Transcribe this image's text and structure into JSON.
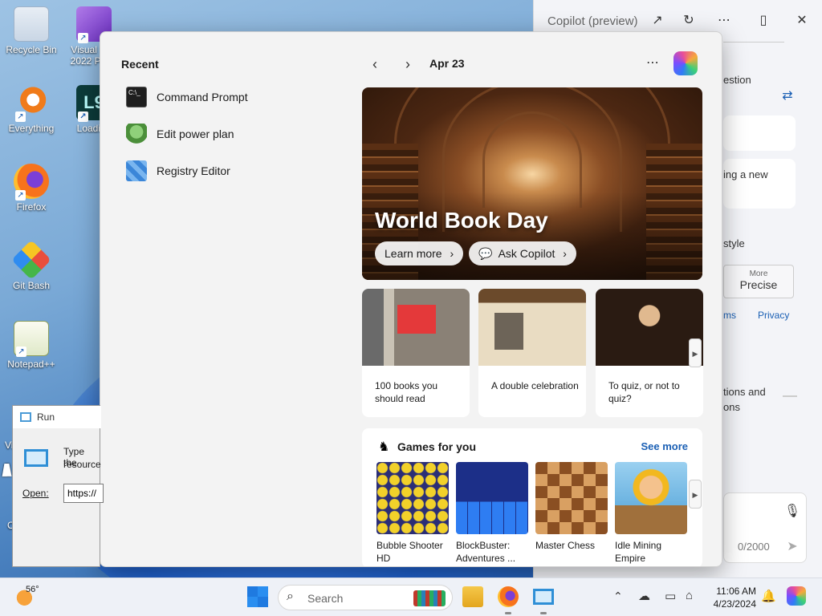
{
  "desktop": {
    "icons": [
      {
        "label": "Recycle Bin"
      },
      {
        "label": "Visual St... 2022 Pre..."
      },
      {
        "label": "Everything"
      },
      {
        "label": "Loading"
      },
      {
        "label": "Firefox"
      },
      {
        "label": "Git Bash"
      },
      {
        "label": "Notepad++"
      }
    ],
    "badge_pre": "PI",
    "partial_text_v": "Vi",
    "partial_text_c": "C"
  },
  "copilot": {
    "title": "Copilot (preview)",
    "icons": [
      "open-external-icon",
      "refresh-icon",
      "more-icon",
      "split-view-icon",
      "close-icon"
    ],
    "snippet_question": "estion",
    "snippet_new": "ing a new",
    "snippet_style": "style",
    "precise_small": "More",
    "precise_label": "Precise",
    "link_terms": "ms",
    "link_privacy": "Privacy",
    "snippet_options_1": "tions and",
    "snippet_options_2": "ons",
    "char_count": "0/2000"
  },
  "start_menu": {
    "recent_header": "Recent",
    "recent_items": [
      {
        "label": "Command Prompt"
      },
      {
        "label": "Edit power plan"
      },
      {
        "label": "Registry Editor"
      }
    ],
    "date": "Apr 23",
    "hero": {
      "title": "World Book Day",
      "learn_more": "Learn more",
      "ask_copilot": "Ask Copilot"
    },
    "cards": [
      {
        "caption": "100 books you should read"
      },
      {
        "caption": "A double celebration"
      },
      {
        "caption": "To quiz, or not to quiz?"
      }
    ],
    "games": {
      "header": "Games for you",
      "see_more": "See more",
      "items": [
        {
          "name": "Bubble Shooter HD"
        },
        {
          "name": "BlockBuster: Adventures ..."
        },
        {
          "name": "Master Chess"
        },
        {
          "name": "Idle Mining Empire"
        }
      ]
    }
  },
  "run_dialog": {
    "title": "Run",
    "prompt_line1": "Type the",
    "prompt_line2": "resource",
    "open_label": "Open:",
    "open_value": "https://"
  },
  "taskbar": {
    "weather_temp": "56°",
    "search_placeholder": "Search",
    "time": "11:06 AM",
    "date": "4/23/2024"
  },
  "colors": {
    "accent": "#1a5fb4",
    "start_bg": "#f3f3f3",
    "copilot_bg": "#f3f4f8",
    "taskbar_bg": "#eef1f7"
  }
}
